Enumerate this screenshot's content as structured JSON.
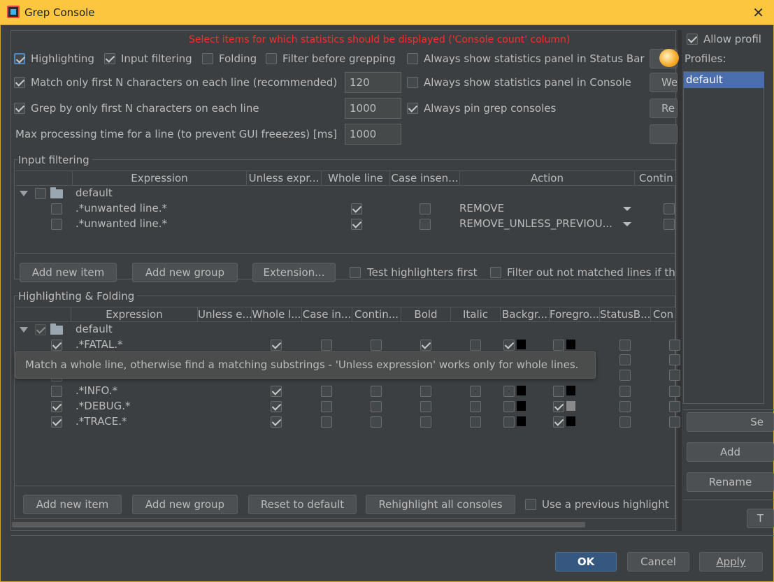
{
  "window": {
    "title": "Grep Console",
    "close_glyph": "✕"
  },
  "notice": "Select items for which statistics should be displayed ('Console count' column)",
  "options": {
    "highlighting": {
      "label": "Highlighting",
      "checked": true
    },
    "input_filtering": {
      "label": "Input filtering",
      "checked": true
    },
    "folding": {
      "label": "Folding",
      "checked": false
    },
    "filter_before": {
      "label": "Filter before grepping",
      "checked": false
    },
    "stats_status_bar": {
      "label": "Always show statistics panel in Status Bar",
      "checked": false
    },
    "match_first_n": {
      "label": "Match only first N characters on each line (recommended)",
      "checked": true,
      "value": "120"
    },
    "stats_console": {
      "label": "Always show statistics panel in Console",
      "checked": false
    },
    "grep_first_n": {
      "label": "Grep by only first N characters on each line",
      "checked": true,
      "value": "1000"
    },
    "pin_consoles": {
      "label": "Always pin grep consoles",
      "checked": true
    },
    "max_time": {
      "label": "Max processing time for a line (to prevent GUI freeezes) [ms]",
      "value": "1000"
    }
  },
  "side_buttons": {
    "b1": "We",
    "b2": "Re",
    "b3": ""
  },
  "input_filtering": {
    "title": "Input filtering",
    "headers": [
      "Expression",
      "Unless expr...",
      "Whole line",
      "Case insen...",
      "Action",
      "Contin"
    ],
    "group": "default",
    "rows": [
      {
        "expression": ".*unwanted line.*",
        "action": "REMOVE"
      },
      {
        "expression": ".*unwanted line.*",
        "action": "REMOVE_UNLESS_PREVIOU..."
      }
    ],
    "buttons": {
      "add_item": "Add new item",
      "add_group": "Add new group",
      "extension": "Extension..."
    },
    "test_first": "Test highlighters first",
    "filter_out": "Filter out not matched lines if th"
  },
  "highlighting": {
    "title": "Highlighting & Folding",
    "headers": [
      "Expression",
      "Unless e...",
      "Whole l...",
      "Case in...",
      "Contin...",
      "Bold",
      "Italic",
      "Backgr...",
      "Foregro...",
      "StatusB...",
      "Con"
    ],
    "group": "default",
    "rows": [
      {
        "expression": ".*FATAL.*"
      },
      {
        "expression": ".*INFO.*"
      },
      {
        "expression": ".*DEBUG.*"
      },
      {
        "expression": ".*TRACE.*"
      }
    ],
    "buttons": {
      "add_item": "Add new item",
      "add_group": "Add new group",
      "reset": "Reset to default",
      "rehighlight": "Rehighlight all consoles"
    },
    "use_previous": "Use a previous highlight"
  },
  "tooltip": "Match a whole line, otherwise find a matching substrings - 'Unless expression' works only for whole lines.",
  "profiles": {
    "allow_label": "Allow profil",
    "label": "Profiles:",
    "items": [
      "default"
    ],
    "buttons": {
      "set": "Se",
      "add": "Add",
      "rename": "Rename",
      "t": "T"
    }
  },
  "footer": {
    "ok": "OK",
    "cancel": "Cancel",
    "apply": "Apply"
  },
  "colors": {
    "accent": "#4b6eaf",
    "warning": "#ff2a2a",
    "title_bar": "#fcc63f"
  }
}
